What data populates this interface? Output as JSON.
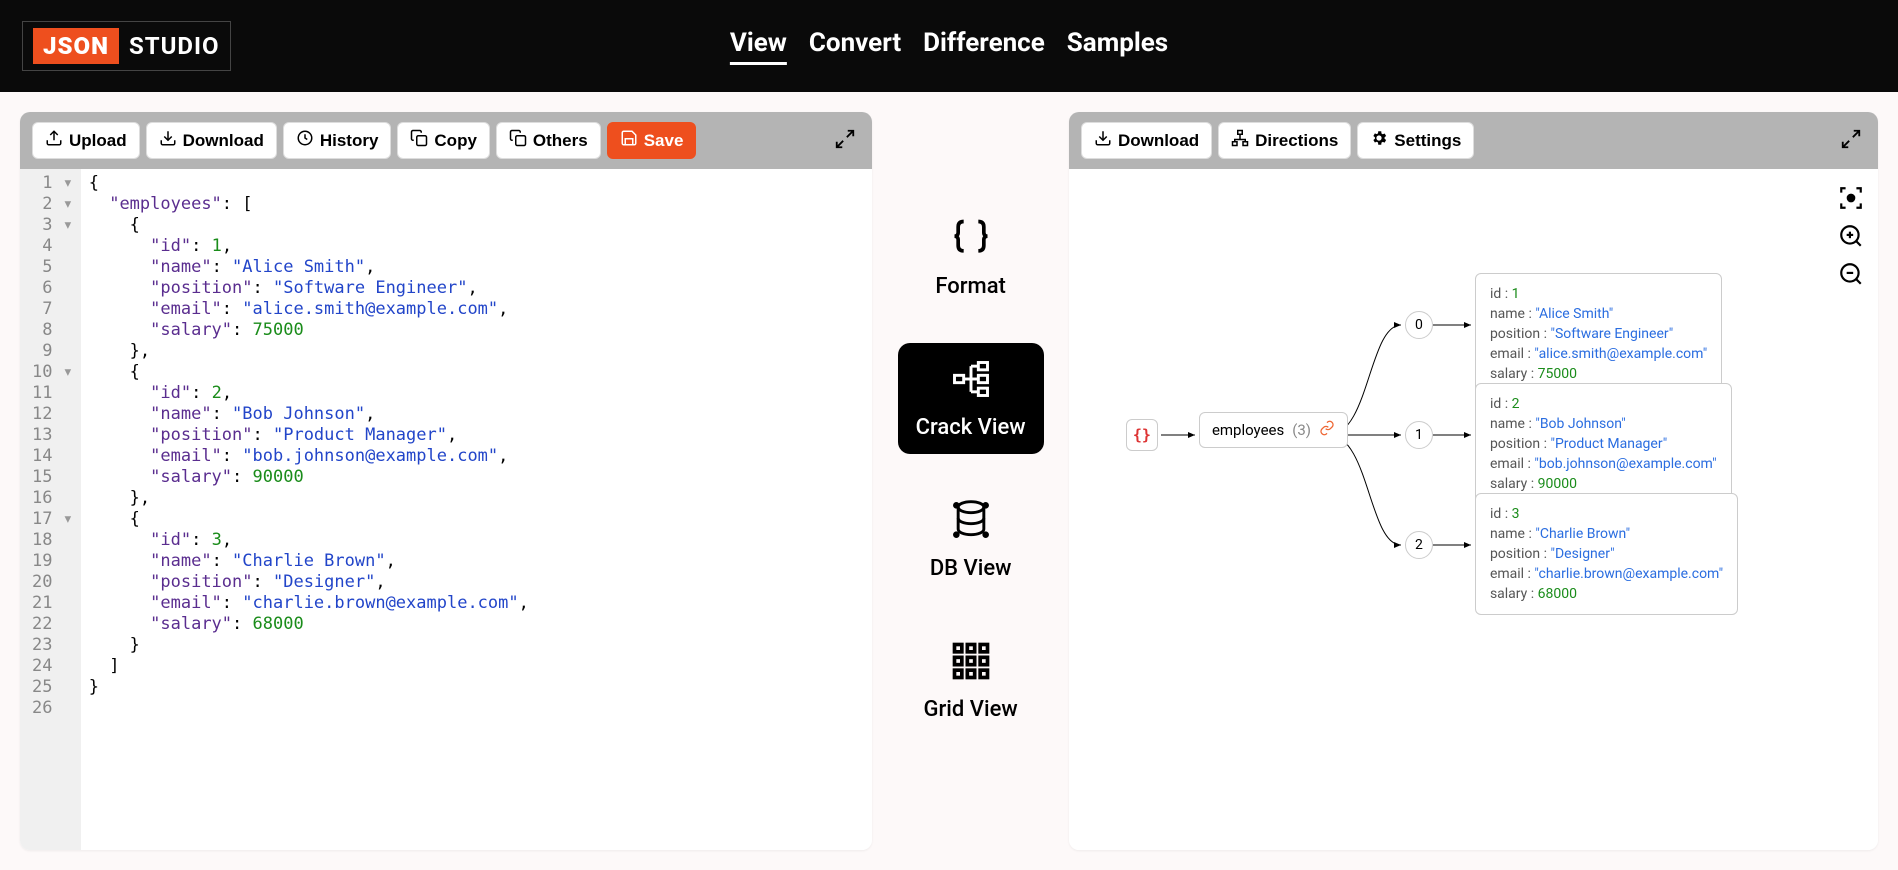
{
  "logo": {
    "json": "JSON",
    "studio": "STUDIO"
  },
  "nav": {
    "view": "View",
    "convert": "Convert",
    "difference": "Difference",
    "samples": "Samples"
  },
  "left_toolbar": {
    "upload": "Upload",
    "download": "Download",
    "history": "History",
    "copy": "Copy",
    "others": "Others",
    "save": "Save"
  },
  "right_toolbar": {
    "download": "Download",
    "directions": "Directions",
    "settings": "Settings"
  },
  "modes": {
    "format": "Format",
    "crack": "Crack View",
    "db": "DB View",
    "grid": "Grid View"
  },
  "code": {
    "lines": [
      {
        "n": 1,
        "fold": true,
        "html": "{"
      },
      {
        "n": 2,
        "fold": true,
        "html": "  <span class='tok-key'>\"employees\"</span>: ["
      },
      {
        "n": 3,
        "fold": true,
        "html": "    {"
      },
      {
        "n": 4,
        "html": "      <span class='tok-key'>\"id\"</span>: <span class='tok-num'>1</span>,"
      },
      {
        "n": 5,
        "html": "      <span class='tok-key'>\"name\"</span>: <span class='tok-str'>\"Alice Smith\"</span>,"
      },
      {
        "n": 6,
        "html": "      <span class='tok-key'>\"position\"</span>: <span class='tok-str'>\"Software Engineer\"</span>,"
      },
      {
        "n": 7,
        "html": "      <span class='tok-key'>\"email\"</span>: <span class='tok-str'>\"alice.smith@example.com\"</span>,"
      },
      {
        "n": 8,
        "html": "      <span class='tok-key'>\"salary\"</span>: <span class='tok-num'>75000</span>"
      },
      {
        "n": 9,
        "html": "    },"
      },
      {
        "n": 10,
        "fold": true,
        "html": "    {"
      },
      {
        "n": 11,
        "html": "      <span class='tok-key'>\"id\"</span>: <span class='tok-num'>2</span>,"
      },
      {
        "n": 12,
        "html": "      <span class='tok-key'>\"name\"</span>: <span class='tok-str'>\"Bob Johnson\"</span>,"
      },
      {
        "n": 13,
        "html": "      <span class='tok-key'>\"position\"</span>: <span class='tok-str'>\"Product Manager\"</span>,"
      },
      {
        "n": 14,
        "html": "      <span class='tok-key'>\"email\"</span>: <span class='tok-str'>\"bob.johnson@example.com\"</span>,"
      },
      {
        "n": 15,
        "html": "      <span class='tok-key'>\"salary\"</span>: <span class='tok-num'>90000</span>"
      },
      {
        "n": 16,
        "html": "    },"
      },
      {
        "n": 17,
        "fold": true,
        "html": "    {"
      },
      {
        "n": 18,
        "html": "      <span class='tok-key'>\"id\"</span>: <span class='tok-num'>3</span>,"
      },
      {
        "n": 19,
        "html": "      <span class='tok-key'>\"name\"</span>: <span class='tok-str'>\"Charlie Brown\"</span>,"
      },
      {
        "n": 20,
        "html": "      <span class='tok-key'>\"position\"</span>: <span class='tok-str'>\"Designer\"</span>,"
      },
      {
        "n": 21,
        "html": "      <span class='tok-key'>\"email\"</span>: <span class='tok-str'>\"charlie.brown@example.com\"</span>,"
      },
      {
        "n": 22,
        "html": "      <span class='tok-key'>\"salary\"</span>: <span class='tok-num'>68000</span>"
      },
      {
        "n": 23,
        "html": "    }"
      },
      {
        "n": 24,
        "html": "  ]"
      },
      {
        "n": 25,
        "html": "}"
      },
      {
        "n": 26,
        "html": ""
      }
    ]
  },
  "graph": {
    "root": "{}",
    "array_label": "employees",
    "array_count": "(3)",
    "indices": [
      "0",
      "1",
      "2"
    ],
    "cards": [
      {
        "id": "1",
        "name": "\"Alice Smith\"",
        "position": "\"Software Engineer\"",
        "email": "\"alice.smith@example.com\"",
        "salary": "75000"
      },
      {
        "id": "2",
        "name": "\"Bob Johnson\"",
        "position": "\"Product Manager\"",
        "email": "\"bob.johnson@example.com\"",
        "salary": "90000"
      },
      {
        "id": "3",
        "name": "\"Charlie Brown\"",
        "position": "\"Designer\"",
        "email": "\"charlie.brown@example.com\"",
        "salary": "68000"
      }
    ],
    "keys": {
      "id": "id :",
      "name": "name :",
      "position": "position :",
      "email": "email :",
      "salary": "salary :"
    }
  }
}
